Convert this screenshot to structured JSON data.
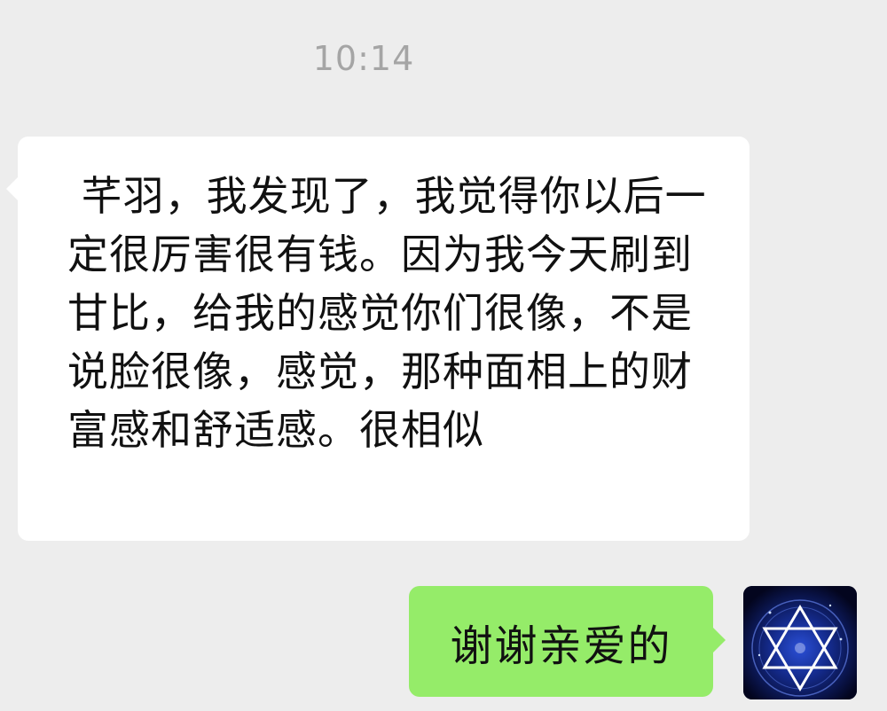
{
  "chat": {
    "timestamp": "10:14",
    "incoming_message": " 芊羽，我发现了，我觉得你以后一定很厉害很有钱。因为我今天刷到甘比，给我的感觉你们很像，不是说脸很像，感觉，那种面相上的财富感和舒适感。很相似",
    "outgoing_message": "谢谢亲爱的"
  },
  "colors": {
    "background": "#ededed",
    "incoming_bubble": "#ffffff",
    "outgoing_bubble": "#95ec69",
    "timestamp_text": "#a5a5a5"
  },
  "icons": {
    "avatar": "star-of-david-icon"
  }
}
